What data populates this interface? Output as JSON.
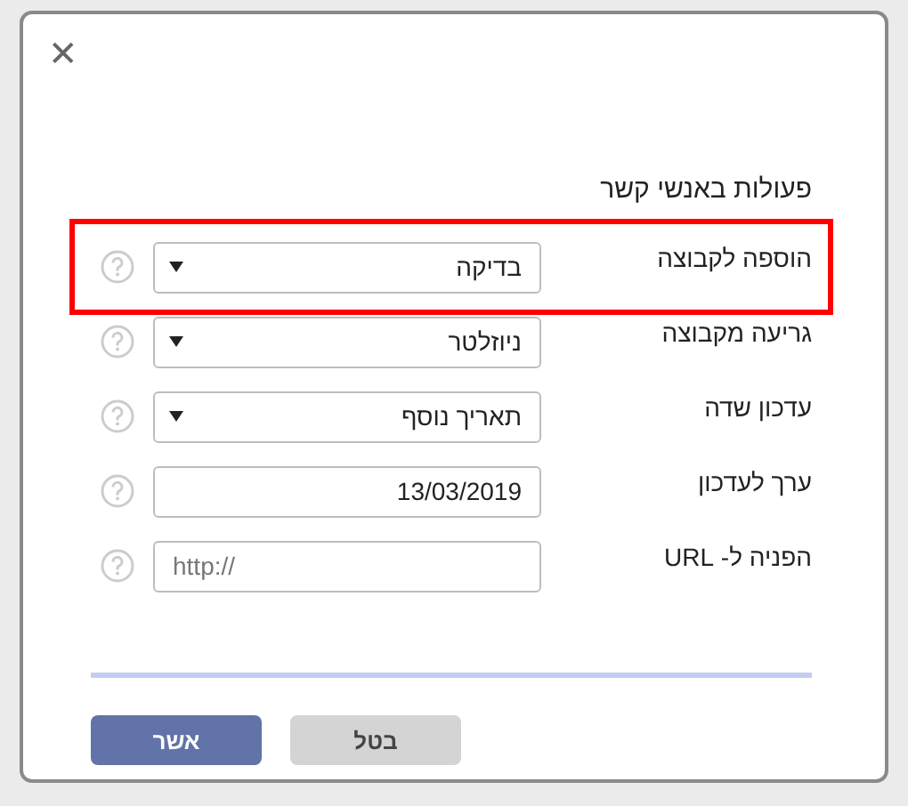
{
  "dialog": {
    "close": "✕",
    "title": "פעולות באנשי קשר",
    "rows": [
      {
        "kind": "select",
        "label": "הוספה לקבוצה",
        "value": "בדיקה",
        "highlighted": true
      },
      {
        "kind": "select",
        "label": "גריעה מקבוצה",
        "value": "ניוזלטר",
        "highlighted": false
      },
      {
        "kind": "select",
        "label": "עדכון שדה",
        "value": "תאריך נוסף",
        "highlighted": false
      },
      {
        "kind": "text",
        "label": "ערך לעדכון",
        "value": "13/03/2019",
        "highlighted": false
      },
      {
        "kind": "url",
        "label": "הפניה ל- URL",
        "placeholder": "http://",
        "highlighted": false
      }
    ],
    "buttons": {
      "confirm": "אשר",
      "cancel": "בטל"
    }
  }
}
